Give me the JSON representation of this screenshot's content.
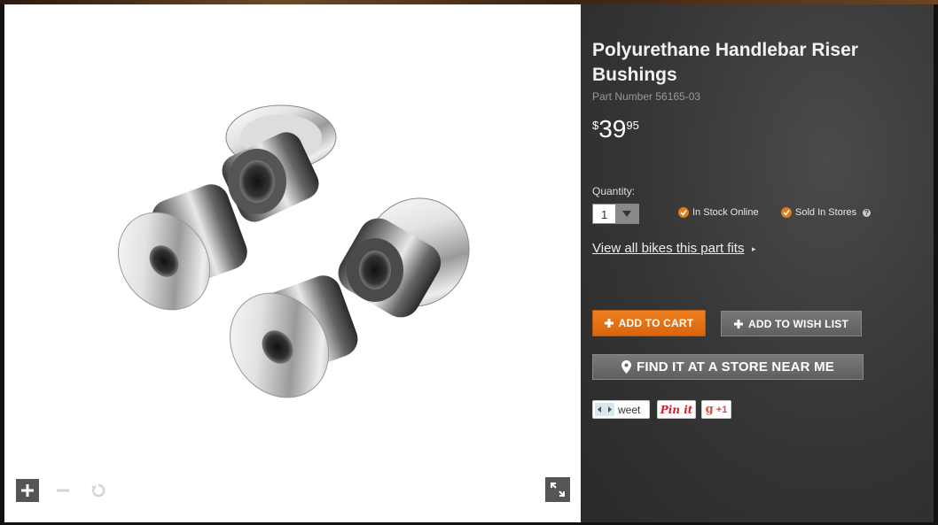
{
  "product": {
    "title": "Polyurethane Handlebar Riser Bushings",
    "part_number": "Part Number 56165-03",
    "price": {
      "currency": "$",
      "dollars": "39",
      "cents": "95"
    }
  },
  "quantity": {
    "label": "Quantity:",
    "value": "1"
  },
  "availability": {
    "online": "In Stock Online",
    "stores": "Sold In Stores",
    "help": "?"
  },
  "fitment_link": "View all bikes this part fits",
  "buttons": {
    "add_to_cart": "ADD TO CART",
    "add_to_wish_list": "ADD TO WISH LIST",
    "find_store": "FIND IT AT A STORE NEAR ME"
  },
  "social": {
    "tweet": "weet",
    "pin": "Pin it",
    "gplus": "+1"
  },
  "colors": {
    "accent": "#e27b1a",
    "panel": "#353535",
    "button_gray": "#6b6b6b"
  },
  "icons": [
    "zoom-in-icon",
    "zoom-out-icon",
    "reset-icon",
    "expand-icon",
    "plus-icon",
    "map-pin-icon",
    "check-icon",
    "help-icon"
  ]
}
